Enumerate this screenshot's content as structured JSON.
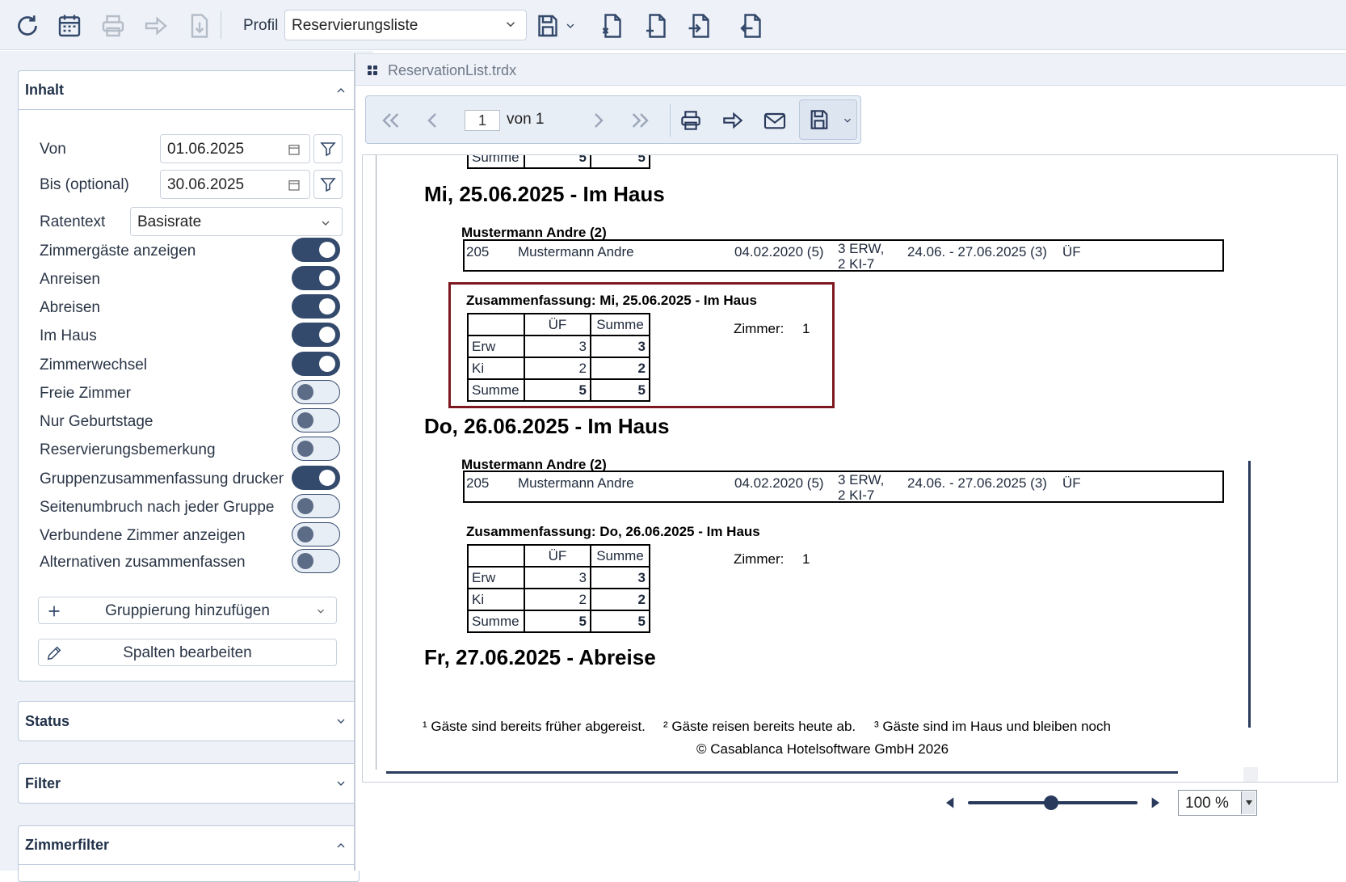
{
  "toolbar": {
    "profil_label": "Profil",
    "profil_value": "Reservierungsliste",
    "icons": [
      "refresh-icon",
      "calendar-icon",
      "print-icon",
      "share-icon",
      "download-icon",
      "save-icon",
      "chevron-down-icon",
      "export-x-icon",
      "file-plus-icon",
      "file-import-icon",
      "file-export-icon"
    ]
  },
  "left": {
    "inhalt": {
      "title": "Inhalt",
      "von_label": "Von",
      "von_value": "01.06.2025",
      "bis_label": "Bis (optional)",
      "bis_value": "30.06.2025",
      "ratentext_label": "Ratentext",
      "ratentext_value": "Basisrate",
      "toggles": [
        {
          "label": "Zimmergäste anzeigen",
          "on": true
        },
        {
          "label": "Anreisen",
          "on": true
        },
        {
          "label": "Abreisen",
          "on": true
        },
        {
          "label": "Im Haus",
          "on": true
        },
        {
          "label": "Zimmerwechsel",
          "on": true
        },
        {
          "label": "Freie Zimmer",
          "on": false
        },
        {
          "label": "Nur Geburtstage",
          "on": false
        },
        {
          "label": "Reservierungsbemerkung",
          "on": false
        },
        {
          "label": "Gruppenzusammenfassung drucken",
          "on": true
        },
        {
          "label": "Seitenumbruch nach jeder Gruppe",
          "on": false
        },
        {
          "label": "Verbundene Zimmer anzeigen",
          "on": false
        },
        {
          "label": "Alternativen zusammenfassen",
          "on": false
        }
      ],
      "add_grouping": "Gruppierung hinzufügen",
      "edit_columns": "Spalten bearbeiten"
    },
    "status_title": "Status",
    "filter_title": "Filter",
    "zimmerfilter_title": "Zimmerfilter"
  },
  "viewer": {
    "tab_title": "ReservationList.trdx",
    "page_current": "1",
    "page_of": "von 1",
    "zoom_value": "100 %"
  },
  "report": {
    "prev_sum_label": "Summe",
    "prev_sum_values": [
      "5",
      "5"
    ],
    "days": [
      {
        "heading": "Mi, 25.06.2025 - Im Haus",
        "group": "Mustermann Andre (2)",
        "row": {
          "room": "205",
          "name": "Mustermann Andre",
          "birth": "04.02.2020 (5)",
          "persons_1": "3 ERW,",
          "persons_2": "2 KI-7",
          "period": "24.06. - 27.06.2025 (3)",
          "board": "ÜF"
        },
        "summary_title": "Zusammenfassung: Mi, 25.06.2025 - Im Haus",
        "header": [
          "",
          "ÜF",
          "Summe"
        ],
        "rows": [
          [
            "Erw",
            "3",
            "3"
          ],
          [
            "Ki",
            "2",
            "2"
          ],
          [
            "Summe",
            "5",
            "5"
          ]
        ],
        "rooms_label": "Zimmer:",
        "rooms_value": "1"
      },
      {
        "heading": "Do, 26.06.2025 - Im Haus",
        "group": "Mustermann Andre (2)",
        "row": {
          "room": "205",
          "name": "Mustermann Andre",
          "birth": "04.02.2020 (5)",
          "persons_1": "3 ERW,",
          "persons_2": "2 KI-7",
          "period": "24.06. - 27.06.2025 (3)",
          "board": "ÜF"
        },
        "summary_title": "Zusammenfassung: Do, 26.06.2025 - Im Haus",
        "header": [
          "",
          "ÜF",
          "Summe"
        ],
        "rows": [
          [
            "Erw",
            "3",
            "3"
          ],
          [
            "Ki",
            "2",
            "2"
          ],
          [
            "Summe",
            "5",
            "5"
          ]
        ],
        "rooms_label": "Zimmer:",
        "rooms_value": "1"
      }
    ],
    "last_heading": "Fr, 27.06.2025 - Abreise",
    "footnote_1": "¹ Gäste sind bereits früher abgereist.",
    "footnote_2": "² Gäste reisen bereits heute ab.",
    "footnote_3": "³ Gäste sind im Haus und bleiben noch",
    "copyright": "© Casablanca Hotelsoftware GmbH 2026"
  }
}
